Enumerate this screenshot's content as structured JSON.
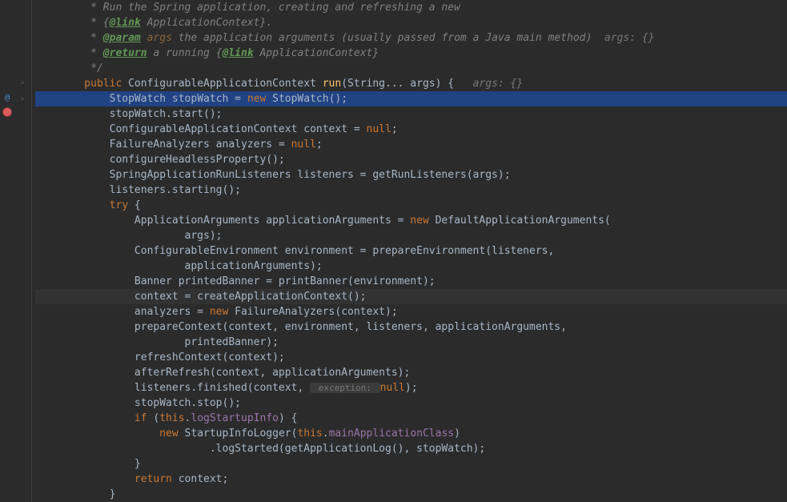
{
  "gutter": {
    "override_marker": "@",
    "breakpoint": "●"
  },
  "code": {
    "doc1": "     * Run the Spring application, creating and refreshing a new",
    "doc2_pre": "     * {",
    "doc2_tag": "@link",
    "doc2_post": " ApplicationContext}.",
    "doc3_pre": "     * ",
    "doc3_tag": "@param",
    "doc3_name": " args ",
    "doc3_post": "the application arguments (usually passed from a Java main method)",
    "doc3_hint": "  args: {}",
    "doc4_pre": "     * ",
    "doc4_tag": "@return",
    "doc4_post": " a running {",
    "doc4_link": "@link",
    "doc4_post2": " ApplicationContext}",
    "doc5": "     */",
    "sig_public": "    public",
    "sig_type": " ConfigurableApplicationContext ",
    "sig_method": "run",
    "sig_params": "(String... args) {",
    "sig_hint": "   args: {}",
    "l1_indent": "        ",
    "l1_type": "StopWatch stopWatch = ",
    "l1_new": "new",
    "l1_ctor": " StopWatch();",
    "l2": "        stopWatch.start();",
    "l3": "        ConfigurableApplicationContext context = ",
    "l3_null": "null",
    "l3_end": ";",
    "l4": "        FailureAnalyzers analyzers = ",
    "l4_null": "null",
    "l4_end": ";",
    "l5": "        configureHeadlessProperty();",
    "l6": "        SpringApplicationRunListeners listeners = getRunListeners(args);",
    "l7": "        listeners.starting();",
    "l8_try": "        try",
    "l8_brace": " {",
    "l9_pre": "            ApplicationArguments applicationArguments = ",
    "l9_new": "new",
    "l9_post": " DefaultApplicationArguments(",
    "l10": "                    args);",
    "l11": "            ConfigurableEnvironment environment = prepareEnvironment(listeners,",
    "l12": "                    applicationArguments);",
    "l13": "            Banner printedBanner = printBanner(environment);",
    "l14": "            context = createApplicationContext();",
    "l15_pre": "            analyzers = ",
    "l15_new": "new",
    "l15_post": " FailureAnalyzers(context);",
    "l16": "            prepareContext(context, environment, listeners, applicationArguments,",
    "l17": "                    printedBanner);",
    "l18": "            refreshContext(context);",
    "l19": "            afterRefresh(context, applicationArguments);",
    "l20_pre": "            listeners.finished(context, ",
    "l20_hint": " exception: ",
    "l20_null": "null",
    "l20_end": ");",
    "l21": "            stopWatch.stop();",
    "l22_if": "            if",
    "l22_cond": " (",
    "l22_this": "this",
    "l22_post": ".",
    "l22_field": "logStartupInfo",
    "l22_end": ") {",
    "l23_pre": "                ",
    "l23_new": "new",
    "l23_ctor": " StartupInfoLogger(",
    "l23_this": "this",
    "l23_dot": ".",
    "l23_field": "mainApplicationClass",
    "l23_end": ")",
    "l24": "                        .logStarted(getApplicationLog(), stopWatch);",
    "l25": "            }",
    "l26_ret": "            return",
    "l26_val": " context;",
    "l27": "        }"
  }
}
